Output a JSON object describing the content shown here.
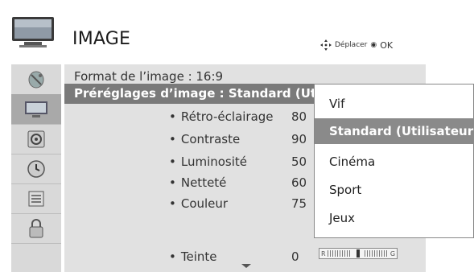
{
  "header": {
    "title": "IMAGE",
    "hint_move": "Déplacer",
    "hint_ok": "OK"
  },
  "sidebar": {
    "items": [
      {
        "icon": "satellite-dish-icon"
      },
      {
        "icon": "tv-screen-icon",
        "active": true
      },
      {
        "icon": "speaker-icon"
      },
      {
        "icon": "clock-icon"
      },
      {
        "icon": "list-icon"
      },
      {
        "icon": "lock-icon"
      }
    ]
  },
  "menu": {
    "aspect_row": "Format de l’image   : 16:9",
    "preset_row": "Préréglages d’image : Standard (Utili",
    "settings": [
      {
        "label": "Rétro-éclairage",
        "value": "80"
      },
      {
        "label": "Contraste",
        "value": "90"
      },
      {
        "label": "Luminosité",
        "value": "50"
      },
      {
        "label": "Netteté",
        "value": "60"
      },
      {
        "label": "Couleur",
        "value": "75"
      },
      {
        "label": "Teinte",
        "value": "0"
      }
    ],
    "tint_left": "R",
    "tint_right": "G"
  },
  "dropdown": {
    "options": [
      "Vif",
      "Standard (Utilisateur)",
      "Cinéma",
      "Sport",
      "Jeux"
    ],
    "selected": "Standard (Utilisateur)"
  }
}
